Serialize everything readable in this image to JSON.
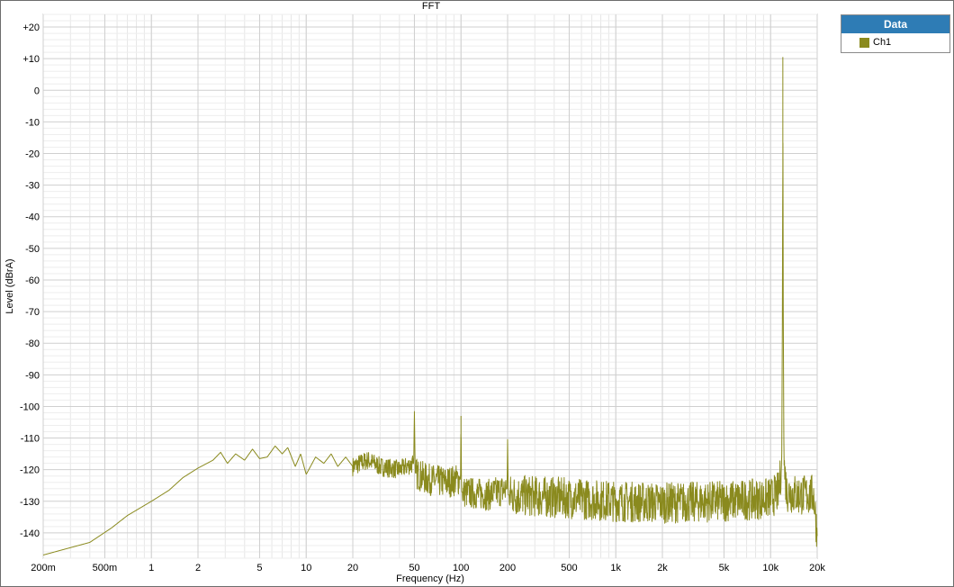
{
  "chart_data": {
    "type": "line",
    "title": "FFT",
    "xlabel": "Frequency (Hz)",
    "ylabel": "Level (dBrA)",
    "x_scale": "log",
    "xlim": [
      0.2,
      20000
    ],
    "ylim": [
      -148,
      24
    ],
    "grid": true,
    "x_ticks": [
      0.2,
      0.5,
      1,
      2,
      5,
      10,
      20,
      50,
      100,
      200,
      500,
      1000,
      2000,
      5000,
      10000,
      20000
    ],
    "x_tick_labels": [
      "200m",
      "500m",
      "1",
      "2",
      "5",
      "10",
      "20",
      "50",
      "100",
      "200",
      "500",
      "1k",
      "2k",
      "5k",
      "10k",
      "20k"
    ],
    "y_ticks": [
      20,
      10,
      0,
      -10,
      -20,
      -30,
      -40,
      -50,
      -60,
      -70,
      -80,
      -90,
      -100,
      -110,
      -120,
      -130,
      -140
    ],
    "y_tick_labels": [
      "+20",
      "+10",
      "0",
      "-10",
      "-20",
      "-30",
      "-40",
      "-50",
      "-60",
      "-70",
      "-80",
      "-90",
      "-100",
      "-110",
      "-120",
      "-130",
      "-140"
    ],
    "legend": {
      "title": "Data",
      "position": "outside-right"
    },
    "series": [
      {
        "name": "Ch1",
        "color": "#8a8a1e",
        "points": [
          [
            0.2,
            -147
          ],
          [
            0.4,
            -143
          ],
          [
            0.55,
            -138.5
          ],
          [
            0.7,
            -134.5
          ],
          [
            1.0,
            -130
          ],
          [
            1.3,
            -126.5
          ],
          [
            1.6,
            -122.5
          ],
          [
            2.0,
            -119.5
          ],
          [
            2.5,
            -117
          ],
          [
            2.8,
            -114.5
          ],
          [
            3.1,
            -118
          ],
          [
            3.5,
            -115
          ],
          [
            4.0,
            -117
          ],
          [
            4.5,
            -113.5
          ],
          [
            5.0,
            -116.5
          ],
          [
            5.6,
            -116
          ],
          [
            6.3,
            -112.5
          ],
          [
            7.0,
            -115
          ],
          [
            7.6,
            -113
          ],
          [
            8.5,
            -119
          ],
          [
            9.2,
            -115
          ],
          [
            10.0,
            -121.5
          ],
          [
            11.5,
            -116
          ],
          [
            13.0,
            -118
          ],
          [
            14.5,
            -115
          ],
          [
            16.0,
            -119
          ],
          [
            18.0,
            -116
          ],
          [
            20.0,
            -119
          ],
          [
            25.0,
            -117
          ],
          [
            30.0,
            -119
          ],
          [
            40.0,
            -120
          ],
          [
            49.5,
            -118
          ],
          [
            50.0,
            -101.5
          ],
          [
            50.6,
            -121
          ],
          [
            60.0,
            -123
          ],
          [
            80.0,
            -124
          ],
          [
            99.3,
            -123
          ],
          [
            100.0,
            -103
          ],
          [
            100.8,
            -127
          ],
          [
            150.0,
            -128
          ],
          [
            198.5,
            -126
          ],
          [
            200.0,
            -110.5
          ],
          [
            202.0,
            -128
          ],
          [
            500.0,
            -129
          ],
          [
            1000.0,
            -130
          ],
          [
            2000.0,
            -130.5
          ],
          [
            5000.0,
            -130
          ],
          [
            10000.0,
            -129
          ],
          [
            11300.0,
            -127
          ],
          [
            11800.0,
            -118
          ],
          [
            11950.0,
            -60
          ],
          [
            12000.0,
            10.5
          ],
          [
            12050.0,
            -60
          ],
          [
            12200.0,
            -118
          ],
          [
            12700.0,
            -127
          ],
          [
            15000.0,
            -128
          ],
          [
            19000.0,
            -128
          ],
          [
            20000.0,
            -141
          ],
          [
            20300.0,
            -148
          ]
        ]
      }
    ]
  }
}
